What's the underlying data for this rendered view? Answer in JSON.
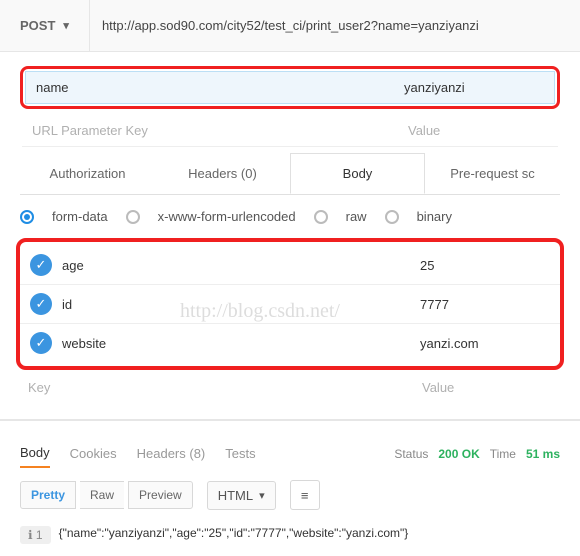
{
  "method": "POST",
  "url": "http://app.sod90.com/city52/test_ci/print_user2?name=yanziyanzi",
  "params": {
    "rows": [
      {
        "key": "name",
        "value": "yanziyanzi"
      }
    ],
    "key_ph": "URL Parameter Key",
    "val_ph": "Value"
  },
  "tabs": {
    "auth": "Authorization",
    "headers": "Headers (0)",
    "body": "Body",
    "pre": "Pre-request sc"
  },
  "bodytype": {
    "form": "form-data",
    "url": "x-www-form-urlencoded",
    "raw": "raw",
    "binary": "binary"
  },
  "form": {
    "rows": [
      {
        "key": "age",
        "value": "25"
      },
      {
        "key": "id",
        "value": "7777"
      },
      {
        "key": "website",
        "value": "yanzi.com"
      }
    ],
    "key_ph": "Key",
    "val_ph": "Value"
  },
  "response": {
    "tabs": {
      "body": "Body",
      "cookies": "Cookies",
      "headers": "Headers (8)",
      "tests": "Tests"
    },
    "status_label": "Status",
    "status": "200 OK",
    "time_label": "Time",
    "time": "51 ms",
    "viewmodes": {
      "pretty": "Pretty",
      "raw": "Raw",
      "preview": "Preview"
    },
    "format": "HTML",
    "line_no": "1",
    "body": "{\"name\":\"yanziyanzi\",\"age\":\"25\",\"id\":\"7777\",\"website\":\"yanzi.com\"}"
  },
  "watermark": "http://blog.csdn.net/"
}
